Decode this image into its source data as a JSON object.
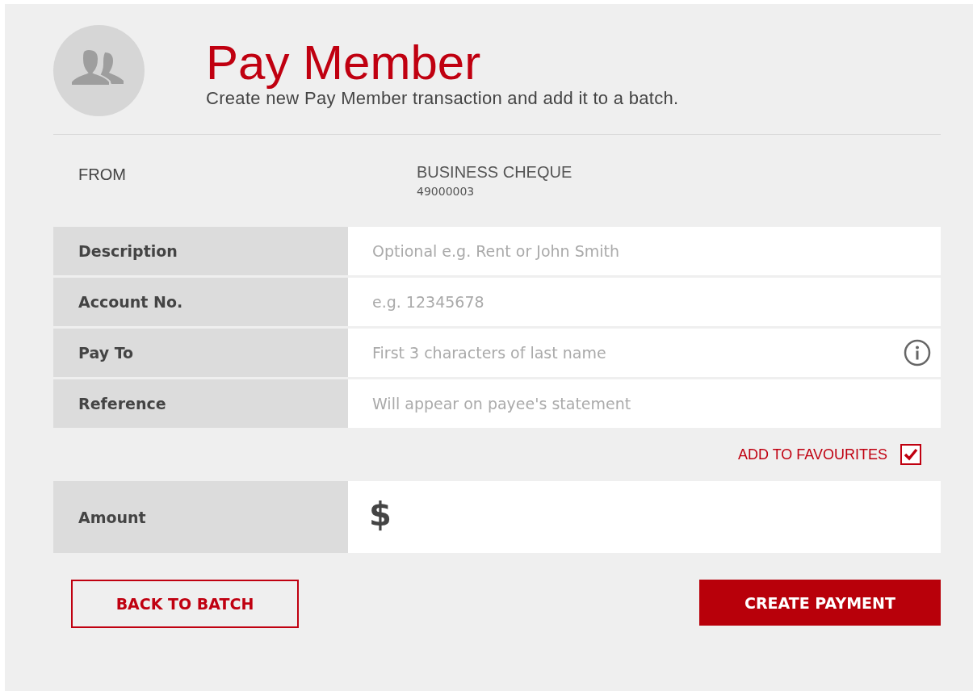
{
  "header": {
    "title": "Pay Member",
    "subtitle": "Create new Pay Member transaction and add it to a batch."
  },
  "from": {
    "label": "FROM",
    "account_name": "BUSINESS CHEQUE",
    "account_number": "49000003"
  },
  "fields": [
    {
      "label": "Description",
      "placeholder": "Optional e.g. Rent or John Smith",
      "info": false
    },
    {
      "label": "Account No.",
      "placeholder": "e.g. 12345678",
      "info": false
    },
    {
      "label": "Pay To",
      "placeholder": "First 3 characters of last name",
      "info": true
    },
    {
      "label": "Reference",
      "placeholder": "Will appear on payee's statement",
      "info": false
    }
  ],
  "favourites": {
    "label": "ADD TO FAVOURITES",
    "checked": true
  },
  "amount": {
    "label": "Amount",
    "currency": "$"
  },
  "buttons": [
    {
      "label": "BACK TO BATCH",
      "kind": "secondary"
    },
    {
      "label": "CREATE PAYMENT",
      "kind": "primary"
    }
  ]
}
